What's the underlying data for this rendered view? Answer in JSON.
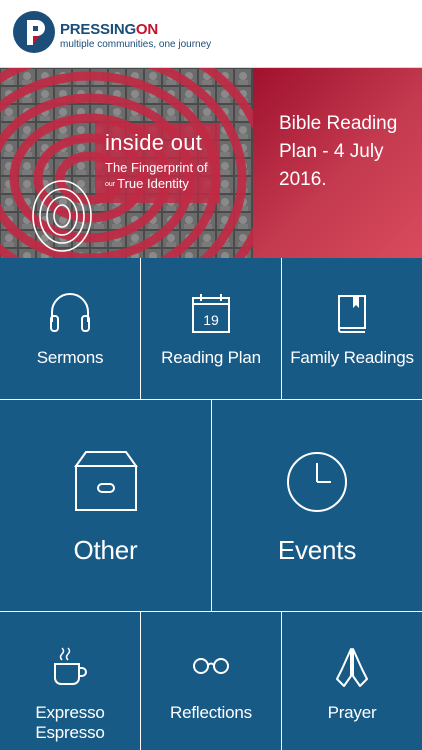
{
  "header": {
    "brand_part1": "PRESSING",
    "brand_part2": "ON",
    "tagline": "multiple communities, one journey",
    "logo_icon": "pressingon-logo-icon"
  },
  "banner": {
    "art_title": "inside out",
    "art_subtitle_line1": "The Fingerprint of",
    "art_subtitle_small": "our",
    "art_subtitle_line2": "True Identity",
    "text": "Bible Reading Plan - 4 July 2016.",
    "colors": {
      "red": "#a0112e",
      "pink": "#c43a4f"
    }
  },
  "tiles": {
    "sermons": {
      "label": "Sermons",
      "icon": "headphones-icon"
    },
    "reading_plan": {
      "label": "Reading Plan",
      "icon": "calendar-icon",
      "calendar_day": "19"
    },
    "family_readings": {
      "label": "Family Readings",
      "icon": "book-icon"
    },
    "other": {
      "label": "Other",
      "icon": "archive-box-icon"
    },
    "events": {
      "label": "Events",
      "icon": "clock-icon"
    },
    "expresso": {
      "label_line1": "Expresso",
      "label_line2": "Espresso",
      "icon": "coffee-cup-icon"
    },
    "reflections": {
      "label": "Reflections",
      "icon": "glasses-icon"
    },
    "prayer": {
      "label": "Prayer",
      "icon": "praying-hands-icon"
    }
  },
  "colors": {
    "tile_blue": "#185a86",
    "brand_blue": "#1b4e78",
    "brand_red": "#c8112f"
  }
}
